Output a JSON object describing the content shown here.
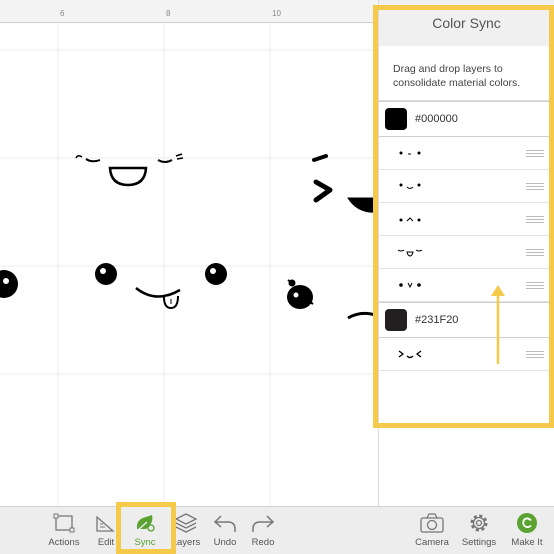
{
  "ruler": {
    "labels": [
      "6",
      "8",
      "10"
    ]
  },
  "color_sync": {
    "title": "Color Sync",
    "description": "Drag and drop layers to consolidate material colors.",
    "groups": [
      {
        "hex": "#000000",
        "swatch_color": "#000000",
        "layers": [
          {
            "thumb": "face-dots-dash"
          },
          {
            "thumb": "face-smile-dots"
          },
          {
            "thumb": "face-caret-mouth"
          },
          {
            "thumb": "face-closed-eyes"
          },
          {
            "thumb": "face-dots-bracket"
          }
        ]
      },
      {
        "hex": "#231F20",
        "swatch_color": "#231F20",
        "layers": [
          {
            "thumb": "face-squint"
          }
        ]
      }
    ]
  },
  "toolbar": {
    "items": [
      {
        "name": "actions",
        "label": "Actions",
        "icon": "actions-icon"
      },
      {
        "name": "edit",
        "label": "Edit",
        "icon": "edit-icon"
      },
      {
        "name": "sync",
        "label": "Sync",
        "icon": "sync-icon",
        "active": true
      },
      {
        "name": "layers",
        "label": "Layers",
        "icon": "layers-icon"
      },
      {
        "name": "undo",
        "label": "Undo",
        "icon": "undo-icon"
      },
      {
        "name": "redo",
        "label": "Redo",
        "icon": "redo-icon"
      },
      {
        "name": "camera",
        "label": "Camera",
        "icon": "camera-icon"
      },
      {
        "name": "settings",
        "label": "Settings",
        "icon": "gear-icon"
      },
      {
        "name": "make-it",
        "label": "Make It",
        "icon": "make-it-icon"
      }
    ]
  },
  "colors": {
    "accent_green": "#5aa332",
    "highlight_yellow": "#f5c94a"
  }
}
